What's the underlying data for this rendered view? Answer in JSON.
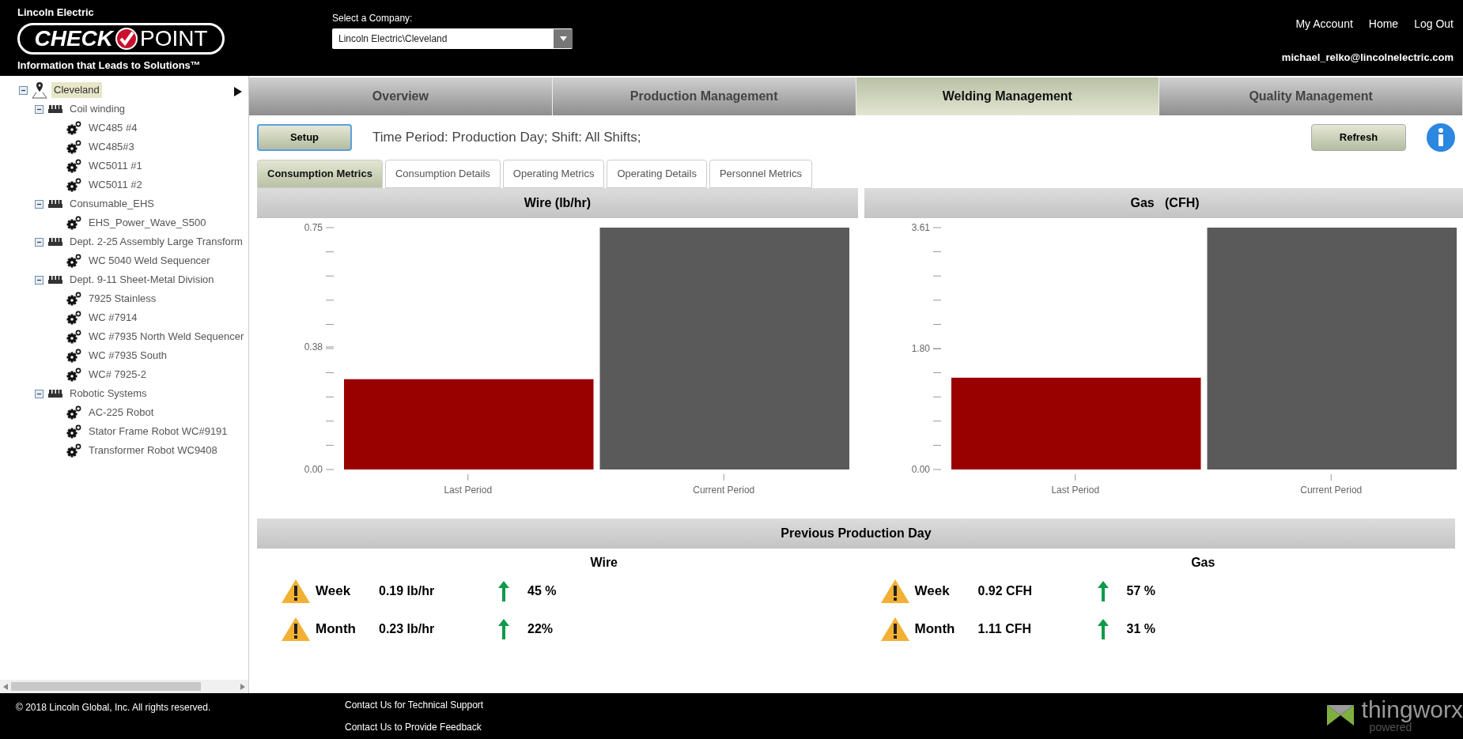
{
  "header": {
    "brand": "Lincoln Electric",
    "logo_left": "CHECK",
    "logo_right": "POINT",
    "tagline": "Information that Leads to Solutions™",
    "company_label": "Select a Company:",
    "company_value": "Lincoln Electric\\Cleveland",
    "links": [
      "My Account",
      "Home",
      "Log Out"
    ],
    "user": "michael_relko@lincolnelectric.com"
  },
  "tree": [
    {
      "label": "Cleveland",
      "kind": "location",
      "selected": true,
      "expanded": true,
      "children": [
        {
          "label": "Coil winding",
          "kind": "department",
          "selected": false,
          "expanded": true,
          "children": [
            {
              "label": "WC485 #4",
              "kind": "machine",
              "selected": false
            },
            {
              "label": "WC485#3",
              "kind": "machine",
              "selected": false
            },
            {
              "label": "WC5011 #1",
              "kind": "machine",
              "selected": false
            },
            {
              "label": "WC5011 #2",
              "kind": "machine",
              "selected": false
            }
          ]
        },
        {
          "label": "Consumable_EHS",
          "kind": "department",
          "selected": false,
          "expanded": true,
          "children": [
            {
              "label": "EHS_Power_Wave_S500",
              "kind": "machine",
              "selected": false
            }
          ]
        },
        {
          "label": "Dept. 2-25 Assembly Large Transform",
          "kind": "department",
          "selected": false,
          "expanded": true,
          "children": [
            {
              "label": "WC 5040 Weld Sequencer",
              "kind": "machine",
              "selected": false
            }
          ]
        },
        {
          "label": "Dept. 9-11 Sheet-Metal Division",
          "kind": "department",
          "selected": false,
          "expanded": true,
          "children": [
            {
              "label": "7925 Stainless",
              "kind": "machine",
              "selected": false
            },
            {
              "label": "WC #7914",
              "kind": "machine",
              "selected": false
            },
            {
              "label": "WC #7935 North Weld Sequencer",
              "kind": "machine",
              "selected": false
            },
            {
              "label": "WC #7935 South",
              "kind": "machine",
              "selected": false
            },
            {
              "label": "WC# 7925-2",
              "kind": "machine",
              "selected": false
            }
          ]
        },
        {
          "label": "Robotic Systems",
          "kind": "department",
          "selected": false,
          "expanded": true,
          "children": [
            {
              "label": "AC-225 Robot",
              "kind": "machine",
              "selected": false
            },
            {
              "label": "Stator Frame Robot WC#9191",
              "kind": "machine",
              "selected": false
            },
            {
              "label": "Transformer Robot WC9408",
              "kind": "machine",
              "selected": false
            }
          ]
        }
      ]
    }
  ],
  "main_tabs": [
    {
      "label": "Overview",
      "selected": false
    },
    {
      "label": "Production Management",
      "selected": false
    },
    {
      "label": "Welding Management",
      "selected": true
    },
    {
      "label": "Quality Management",
      "selected": false
    }
  ],
  "setup_button": "Setup",
  "time_period": "Time Period: Production Day; Shift: All Shifts;",
  "refresh_button": "Refresh",
  "sub_tabs": [
    {
      "label": "Consumption Metrics",
      "selected": true
    },
    {
      "label": "Consumption Details",
      "selected": false
    },
    {
      "label": "Operating Metrics",
      "selected": false
    },
    {
      "label": "Operating Details",
      "selected": false
    },
    {
      "label": "Personnel Metrics",
      "selected": false
    }
  ],
  "charts": [
    {
      "title": "Wire (lb/hr)",
      "chart_data": {
        "type": "bar",
        "categories": [
          "Last Period",
          "Current Period"
        ],
        "series": [
          {
            "color": "#990000",
            "values": [
              0.28,
              null
            ]
          },
          {
            "color": "#5a5a5a",
            "values": [
              null,
              0.75
            ]
          }
        ],
        "ylim": [
          0,
          0.75
        ],
        "yticks": [
          {
            "value": 0,
            "label": "0.00"
          },
          {
            "value": 0.38,
            "label": "0.38"
          },
          {
            "value": 0.75,
            "label": "0.75"
          }
        ]
      }
    },
    {
      "title": "Gas   (CFH)",
      "chart_data": {
        "type": "bar",
        "categories": [
          "Last Period",
          "Current Period"
        ],
        "series": [
          {
            "color": "#990000",
            "values": [
              1.37,
              null
            ]
          },
          {
            "color": "#5a5a5a",
            "values": [
              null,
              3.61
            ]
          }
        ],
        "ylim": [
          0,
          3.61
        ],
        "yticks": [
          {
            "value": 0,
            "label": "0.00"
          },
          {
            "value": 1.8,
            "label": "1.80"
          },
          {
            "value": 3.61,
            "label": "3.61"
          }
        ]
      }
    }
  ],
  "summary": {
    "title": "Previous Production Day",
    "groups": [
      {
        "title": "Wire",
        "rows": [
          {
            "label": "Week",
            "value": "0.19 lb/hr",
            "kind": "up",
            "change": "45 %"
          },
          {
            "label": "Month",
            "value": "0.23 lb/hr",
            "kind": "up",
            "change": "22%"
          }
        ]
      },
      {
        "title": "Gas",
        "rows": [
          {
            "label": "Week",
            "value": "0.92 CFH",
            "kind": "up",
            "change": "57 %"
          },
          {
            "label": "Month",
            "value": "1.11 CFH",
            "kind": "up",
            "change": "31 %"
          }
        ]
      }
    ]
  },
  "footer": {
    "copyright": "© 2018 Lincoln Global, Inc. All rights reserved.",
    "links": [
      "Contact Us for Technical Support",
      "Contact Us to Provide Feedback"
    ],
    "vendor": "thingworx",
    "vendor_sub": "powered"
  }
}
